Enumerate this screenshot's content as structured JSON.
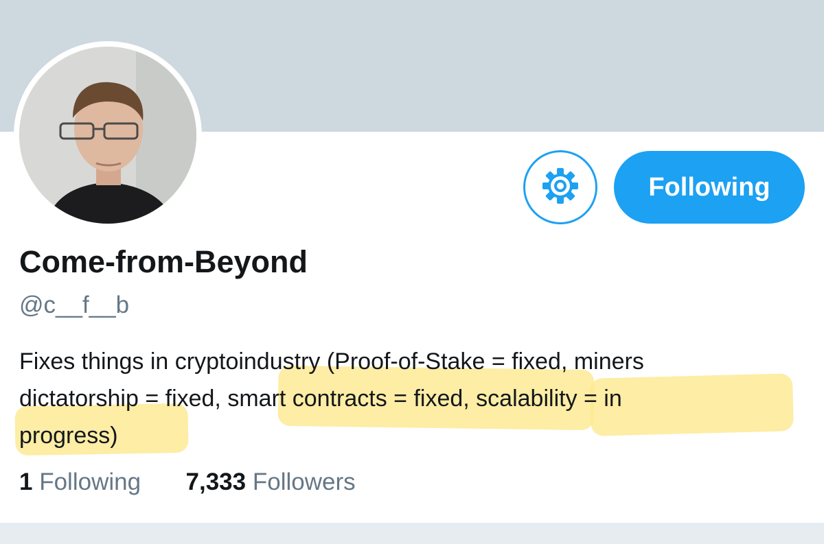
{
  "profile": {
    "name": "Come-from-Beyond",
    "handle": "@c__f__b",
    "bio_lines": [
      "Fixes things in cryptoindustry (Proof-of-Stake = fixed, miners",
      "dictatorship = fixed, smart contracts = fixed, scalability = in",
      "progress)"
    ],
    "following_button_label": "Following",
    "stats": {
      "following_count": "1",
      "following_label": "Following",
      "followers_count": "7,333",
      "followers_label": "Followers"
    }
  },
  "icons": {
    "settings": "gear-icon"
  },
  "colors": {
    "accent": "#1da1f2",
    "banner": "#cdd8df",
    "highlight": "#fde98e",
    "text": "#14171a",
    "secondary_text": "#657786"
  }
}
